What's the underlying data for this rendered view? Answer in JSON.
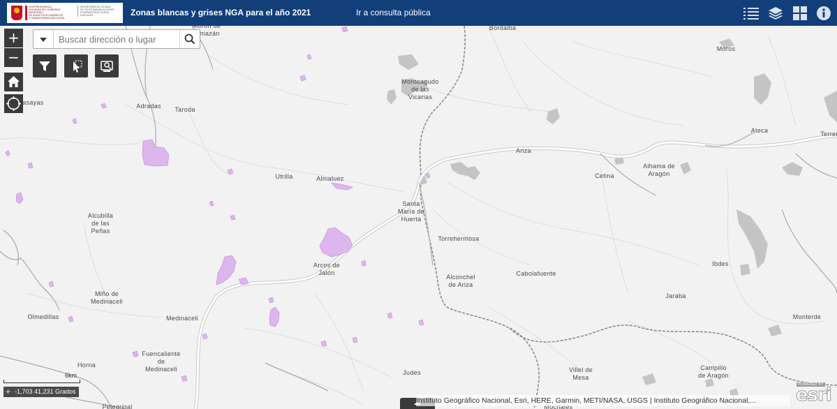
{
  "header": {
    "title": "Zonas blancas y grises NGA para el año 2021",
    "consult_link": "Ir a consulta pública",
    "logo_ministry_lines": [
      "VICEPRESIDENCIA",
      "SEGUNDA DEL GOBIERNO",
      "",
      "MINISTERIO",
      "DE ASUNTOS ECONÓMICOS",
      "Y TRANSFORMACIÓN DIGITAL"
    ],
    "logo_secretariat_lines": [
      "SECRETARÍA DE ESTADO",
      "DE TELECOMUNICACIONES",
      "E INFRAESTRUCTURAS",
      "DIGITALES"
    ],
    "logo_crown_text": [
      "GOBIERNO",
      "DE ESPAÑA"
    ],
    "icons": [
      "list-icon",
      "layers-icon",
      "grid-icon",
      "info-icon"
    ]
  },
  "search": {
    "placeholder": "Buscar dirección o lugar"
  },
  "controls": {
    "zoom_in": "+",
    "zoom_out": "−"
  },
  "map": {
    "places": {
      "moron": "Morón de",
      "almazan": "Almazán",
      "bordalba": "Bordalba",
      "moros": "Moros",
      "monteagudo_1": "Monteagudo",
      "monteagudo_2": "de las",
      "monteagudo_3": "Vicarias",
      "casayas": "Casayas",
      "adradas": "Adradas",
      "taroda": "Taroda",
      "ateca": "Ateca",
      "terrer": "Terrer",
      "ariza": "Ariza",
      "alhama_1": "Alhama de",
      "alhama_2": "Aragón",
      "cetina": "Cetina",
      "utrilla": "Utrilla",
      "almaluez": "Almaluez",
      "santa_maria_1": "Santa",
      "santa_maria_2": "María de",
      "santa_maria_3": "Huerta",
      "alcubilla_1": "Alcubilla",
      "alcubilla_2": "de las",
      "alcubilla_3": "Peñas",
      "torrehermosa": "Torrehermosa",
      "arcos_1": "Arcos de",
      "arcos_2": "Jalón",
      "ibdes": "Ibdes",
      "alconchel_1": "Alconchel",
      "alconchel_2": "de Ariza",
      "cabolafuente": "Cabolafuente",
      "mino_1": "Miño de",
      "mino_2": "Medinaceli",
      "jaraba": "Jaraba",
      "olmedillas": "Olmedillas",
      "medinaceli": "Medinaceli",
      "monterde": "Monterde",
      "fuencaliente_1": "Fuencaliente",
      "fuencaliente_2": "de",
      "fuencaliente_3": "Medinaceli",
      "horna": "Horna",
      "judes": "Judes",
      "villel_1": "Villel de",
      "villel_2": "Mesa",
      "campillo_1": "Campillo",
      "campillo_2": "de Aragón",
      "pelegrinal": "Pelegrinal",
      "mochales": "Mochales"
    }
  },
  "scale_label": "6km",
  "coordinates": "-1,703 41,231 Grados",
  "attribution": "Instituto Geográfico Nacional, Esri, HERE, Garmin, METI/NASA, USGS | Instituto Geográfico Nacional,...",
  "esri": {
    "powered_by": "POWERED BY",
    "wordmark": "esri"
  }
}
